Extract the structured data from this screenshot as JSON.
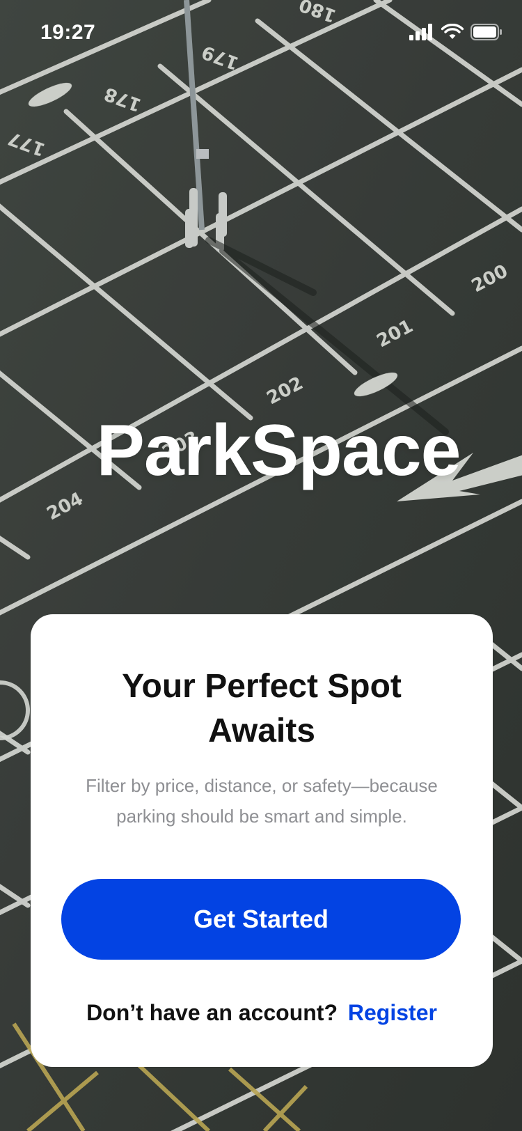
{
  "status_bar": {
    "time": "19:27",
    "icons": [
      "cellular-signal-icon",
      "wifi-icon",
      "battery-icon"
    ]
  },
  "brand": {
    "name": "ParkSpace"
  },
  "background": {
    "parking_numbers": [
      "180",
      "179",
      "178",
      "177",
      "200",
      "201",
      "202",
      "203",
      "204"
    ]
  },
  "onboarding_card": {
    "title": "Your Perfect Spot Awaits",
    "subtitle": "Filter by price, distance, or safety—because parking should be smart and simple.",
    "cta_label": "Get Started",
    "account_prompt": "Don’t have an account?",
    "register_label": "Register"
  },
  "colors": {
    "accent": "#0343E3",
    "card_background": "#FFFFFF",
    "title_text": "#111111",
    "subtitle_text": "#8E8F93",
    "asphalt": "#3A3F3B",
    "lane_paint": "#E9ECE6"
  }
}
